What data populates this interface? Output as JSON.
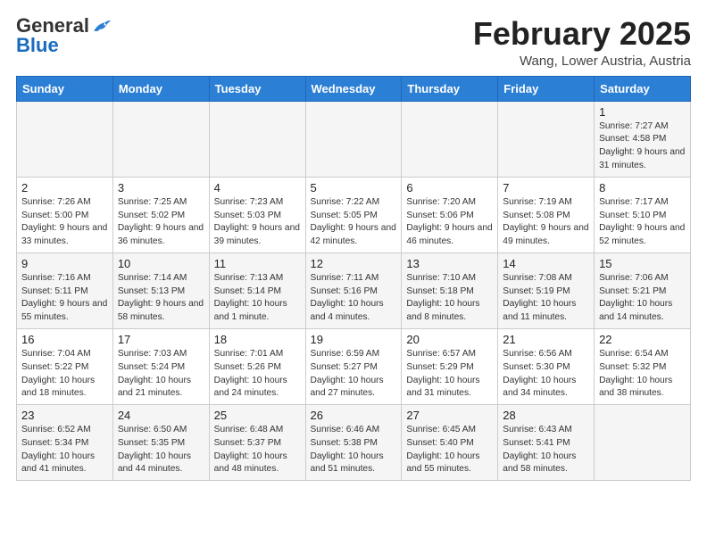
{
  "logo": {
    "general": "General",
    "blue": "Blue"
  },
  "title": "February 2025",
  "subtitle": "Wang, Lower Austria, Austria",
  "days": [
    "Sunday",
    "Monday",
    "Tuesday",
    "Wednesday",
    "Thursday",
    "Friday",
    "Saturday"
  ],
  "weeks": [
    [
      {
        "day": "",
        "info": ""
      },
      {
        "day": "",
        "info": ""
      },
      {
        "day": "",
        "info": ""
      },
      {
        "day": "",
        "info": ""
      },
      {
        "day": "",
        "info": ""
      },
      {
        "day": "",
        "info": ""
      },
      {
        "day": "1",
        "info": "Sunrise: 7:27 AM\nSunset: 4:58 PM\nDaylight: 9 hours and 31 minutes."
      }
    ],
    [
      {
        "day": "2",
        "info": "Sunrise: 7:26 AM\nSunset: 5:00 PM\nDaylight: 9 hours and 33 minutes."
      },
      {
        "day": "3",
        "info": "Sunrise: 7:25 AM\nSunset: 5:02 PM\nDaylight: 9 hours and 36 minutes."
      },
      {
        "day": "4",
        "info": "Sunrise: 7:23 AM\nSunset: 5:03 PM\nDaylight: 9 hours and 39 minutes."
      },
      {
        "day": "5",
        "info": "Sunrise: 7:22 AM\nSunset: 5:05 PM\nDaylight: 9 hours and 42 minutes."
      },
      {
        "day": "6",
        "info": "Sunrise: 7:20 AM\nSunset: 5:06 PM\nDaylight: 9 hours and 46 minutes."
      },
      {
        "day": "7",
        "info": "Sunrise: 7:19 AM\nSunset: 5:08 PM\nDaylight: 9 hours and 49 minutes."
      },
      {
        "day": "8",
        "info": "Sunrise: 7:17 AM\nSunset: 5:10 PM\nDaylight: 9 hours and 52 minutes."
      }
    ],
    [
      {
        "day": "9",
        "info": "Sunrise: 7:16 AM\nSunset: 5:11 PM\nDaylight: 9 hours and 55 minutes."
      },
      {
        "day": "10",
        "info": "Sunrise: 7:14 AM\nSunset: 5:13 PM\nDaylight: 9 hours and 58 minutes."
      },
      {
        "day": "11",
        "info": "Sunrise: 7:13 AM\nSunset: 5:14 PM\nDaylight: 10 hours and 1 minute."
      },
      {
        "day": "12",
        "info": "Sunrise: 7:11 AM\nSunset: 5:16 PM\nDaylight: 10 hours and 4 minutes."
      },
      {
        "day": "13",
        "info": "Sunrise: 7:10 AM\nSunset: 5:18 PM\nDaylight: 10 hours and 8 minutes."
      },
      {
        "day": "14",
        "info": "Sunrise: 7:08 AM\nSunset: 5:19 PM\nDaylight: 10 hours and 11 minutes."
      },
      {
        "day": "15",
        "info": "Sunrise: 7:06 AM\nSunset: 5:21 PM\nDaylight: 10 hours and 14 minutes."
      }
    ],
    [
      {
        "day": "16",
        "info": "Sunrise: 7:04 AM\nSunset: 5:22 PM\nDaylight: 10 hours and 18 minutes."
      },
      {
        "day": "17",
        "info": "Sunrise: 7:03 AM\nSunset: 5:24 PM\nDaylight: 10 hours and 21 minutes."
      },
      {
        "day": "18",
        "info": "Sunrise: 7:01 AM\nSunset: 5:26 PM\nDaylight: 10 hours and 24 minutes."
      },
      {
        "day": "19",
        "info": "Sunrise: 6:59 AM\nSunset: 5:27 PM\nDaylight: 10 hours and 27 minutes."
      },
      {
        "day": "20",
        "info": "Sunrise: 6:57 AM\nSunset: 5:29 PM\nDaylight: 10 hours and 31 minutes."
      },
      {
        "day": "21",
        "info": "Sunrise: 6:56 AM\nSunset: 5:30 PM\nDaylight: 10 hours and 34 minutes."
      },
      {
        "day": "22",
        "info": "Sunrise: 6:54 AM\nSunset: 5:32 PM\nDaylight: 10 hours and 38 minutes."
      }
    ],
    [
      {
        "day": "23",
        "info": "Sunrise: 6:52 AM\nSunset: 5:34 PM\nDaylight: 10 hours and 41 minutes."
      },
      {
        "day": "24",
        "info": "Sunrise: 6:50 AM\nSunset: 5:35 PM\nDaylight: 10 hours and 44 minutes."
      },
      {
        "day": "25",
        "info": "Sunrise: 6:48 AM\nSunset: 5:37 PM\nDaylight: 10 hours and 48 minutes."
      },
      {
        "day": "26",
        "info": "Sunrise: 6:46 AM\nSunset: 5:38 PM\nDaylight: 10 hours and 51 minutes."
      },
      {
        "day": "27",
        "info": "Sunrise: 6:45 AM\nSunset: 5:40 PM\nDaylight: 10 hours and 55 minutes."
      },
      {
        "day": "28",
        "info": "Sunrise: 6:43 AM\nSunset: 5:41 PM\nDaylight: 10 hours and 58 minutes."
      },
      {
        "day": "",
        "info": ""
      }
    ]
  ]
}
